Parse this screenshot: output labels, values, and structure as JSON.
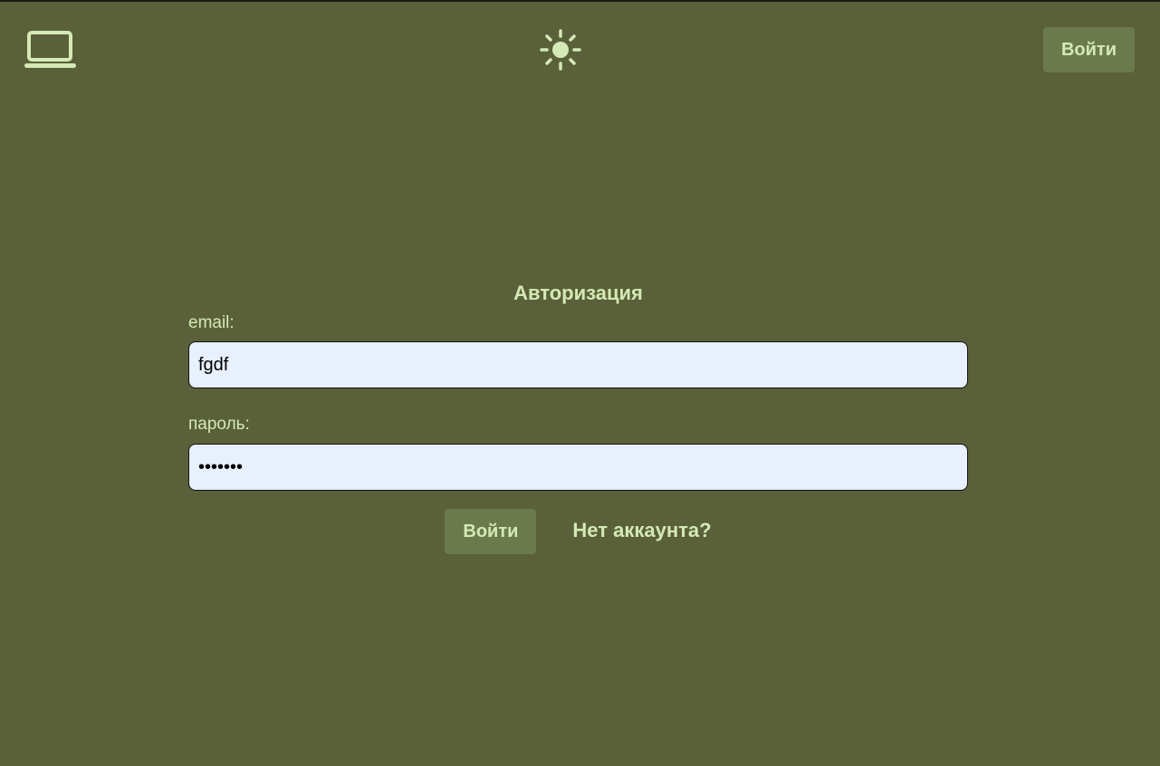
{
  "header": {
    "logo_icon": "laptop-icon",
    "theme_icon": "sun-icon",
    "login_label": "Войти"
  },
  "form": {
    "title": "Авторизация",
    "email_label": "email:",
    "email_value": "fgdf",
    "password_label": "пароль:",
    "password_value": "1234567",
    "submit_label": "Войти",
    "register_link": "Нет аккаунта?"
  },
  "colors": {
    "background": "#5a6039",
    "accent_text": "#d4e9b5",
    "button_bg": "#6b7a4c",
    "input_bg": "#e8effd"
  }
}
